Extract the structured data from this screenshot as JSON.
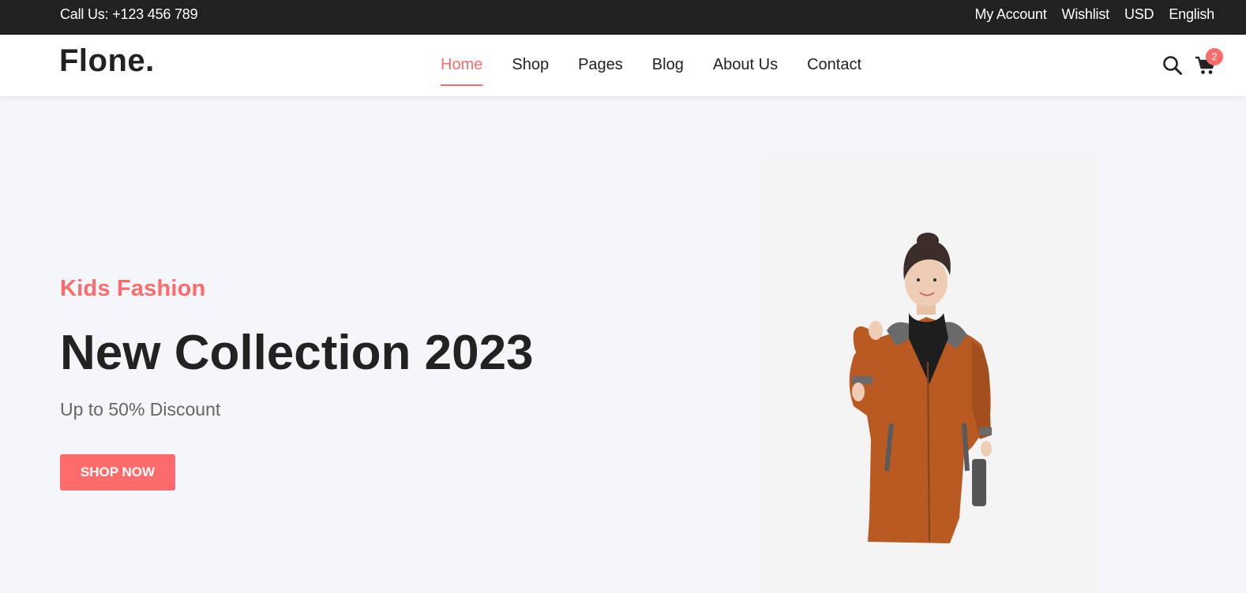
{
  "topbar": {
    "call": "Call Us: +123 456 789",
    "links": [
      "My Account",
      "Wishlist",
      "USD",
      "English"
    ]
  },
  "navbar": {
    "logo": "Flone.",
    "menu": [
      "Home",
      "Shop",
      "Pages",
      "Blog",
      "About Us",
      "Contact"
    ],
    "active_item": "Home",
    "cart_count": "2",
    "icons": {
      "search": "search-icon",
      "cart": "cart-icon"
    }
  },
  "hero": {
    "subtitle": "Kids Fashion",
    "headline": "New Collection 2023",
    "discount": "Up to 50% Discount",
    "button": "SHOP NOW"
  },
  "colors": {
    "accent": "#ff6b6b",
    "topbar_bg": "#212121",
    "page_bg": "#f5f6fa",
    "coat": "#b95a22"
  }
}
